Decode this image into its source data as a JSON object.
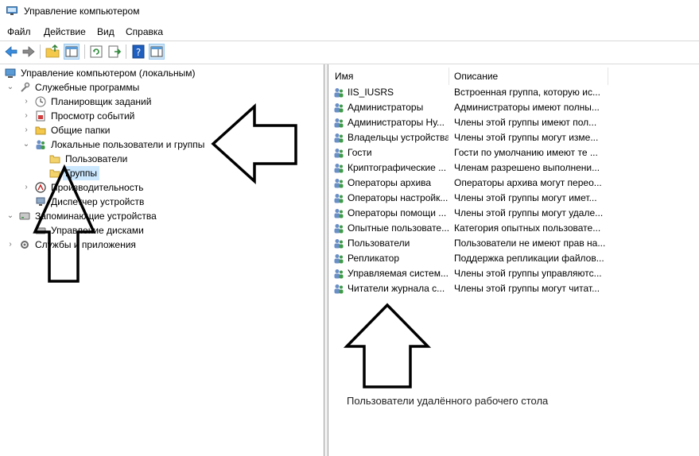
{
  "window": {
    "title": "Управление компьютером"
  },
  "menu": [
    "Файл",
    "Действие",
    "Вид",
    "Справка"
  ],
  "tree": {
    "root": "Управление компьютером (локальным)",
    "system_tools": "Служебные программы",
    "task_scheduler": "Планировщик заданий",
    "event_viewer": "Просмотр событий",
    "shared_folders": "Общие папки",
    "local_users_groups": "Локальные пользователи и группы",
    "users": "Пользователи",
    "groups": "Группы",
    "performance": "Производительность",
    "device_manager": "Диспетчер устройств",
    "storage": "Запоминающие устройства",
    "disk_management": "Управление дисками",
    "services_apps": "Службы и приложения"
  },
  "list": {
    "columns": [
      "Имя",
      "Описание"
    ],
    "rows": [
      {
        "name": "IIS_IUSRS",
        "desc": "Встроенная группа, которую ис..."
      },
      {
        "name": "Администраторы",
        "desc": "Администраторы имеют полны..."
      },
      {
        "name": "Администраторы Ну...",
        "desc": "Члены этой группы имеют пол..."
      },
      {
        "name": "Владельцы устройства",
        "desc": "Члены этой группы могут изме..."
      },
      {
        "name": "Гости",
        "desc": "Гости по умолчанию имеют те ..."
      },
      {
        "name": "Криптографические ...",
        "desc": "Членам разрешено выполнени..."
      },
      {
        "name": "Операторы архива",
        "desc": "Операторы архива могут перео..."
      },
      {
        "name": "Операторы настройк...",
        "desc": "Члены этой группы могут имет..."
      },
      {
        "name": "Операторы помощи ...",
        "desc": "Члены этой группы могут удале..."
      },
      {
        "name": "Опытные пользовате...",
        "desc": "Категория опытных пользовате..."
      },
      {
        "name": "Пользователи",
        "desc": "Пользователи не имеют прав на..."
      },
      {
        "name": "Репликатор",
        "desc": "Поддержка репликации файлов..."
      },
      {
        "name": "Управляемая систем...",
        "desc": "Члены этой группы управляютс..."
      },
      {
        "name": "Читатели журнала с...",
        "desc": "Члены этой группы могут читат..."
      }
    ]
  },
  "annotation": "Пользователи удалённого рабочего стола"
}
